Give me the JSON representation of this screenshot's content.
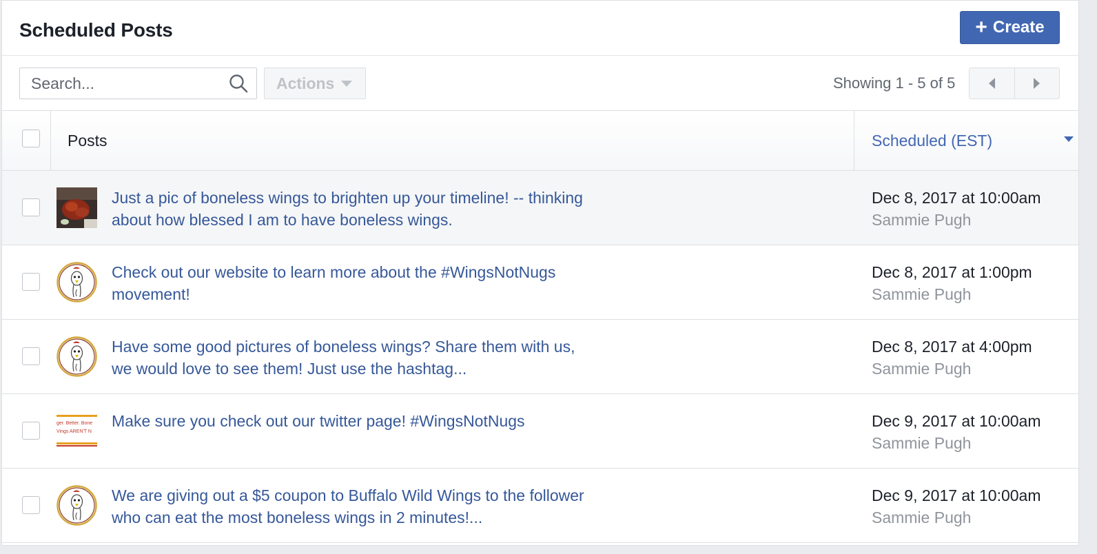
{
  "header": {
    "title": "Scheduled Posts",
    "create_label": "Create",
    "create_color": "#4267b2"
  },
  "toolbar": {
    "search_placeholder": "Search...",
    "actions_label": "Actions",
    "showing_text": "Showing 1 - 5 of 5"
  },
  "table": {
    "col_posts": "Posts",
    "col_scheduled": "Scheduled (EST)",
    "rows": [
      {
        "text": "Just a pic of boneless wings to brighten up your timeline! -- thinking about how blessed I am to have boneless wings.",
        "date": "Dec 8, 2017 at 10:00am",
        "author": "Sammie Pugh",
        "thumb": "food-photo"
      },
      {
        "text": "Check out our website to learn more about the #WingsNotNugs movement!",
        "date": "Dec 8, 2017 at 1:00pm",
        "author": "Sammie Pugh",
        "thumb": "chicken-logo"
      },
      {
        "text": "Have some good pictures of boneless wings? Share them with us, we would love to see them! Just use the hashtag...",
        "date": "Dec 8, 2017 at 4:00pm",
        "author": "Sammie Pugh",
        "thumb": "chicken-logo"
      },
      {
        "text": "Make sure you check out our twitter page! #WingsNotNugs",
        "date": "Dec 9, 2017 at 10:00am",
        "author": "Sammie Pugh",
        "thumb": "banner-image",
        "thumb_text_1": "ger. Better. Bone",
        "thumb_text_2": "Vings AREN'T N"
      },
      {
        "text": "We are giving out a $5 coupon to Buffalo Wild Wings to the follower who can eat the most boneless wings in 2 minutes!...",
        "date": "Dec 9, 2017 at 10:00am",
        "author": "Sammie Pugh",
        "thumb": "chicken-logo"
      }
    ]
  }
}
